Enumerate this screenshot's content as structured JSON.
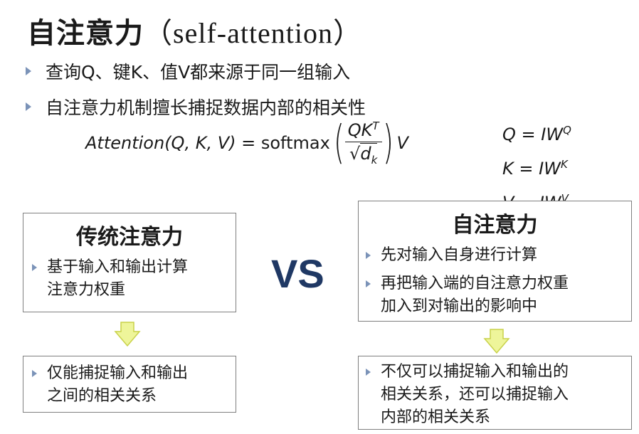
{
  "title": {
    "cn": "自注意力",
    "latin": "（self-attention）"
  },
  "bullets": [
    "查询Q、键K、值V都来源于同一组输入",
    "自注意力机制擅长捕捉数据内部的相关性"
  ],
  "formula": {
    "lhs": "Attention(Q, K, V)",
    "eq": " = softmax",
    "num": "QK",
    "num_sup": "T",
    "den": "d",
    "den_sub": "k",
    "tail": "V"
  },
  "equations": [
    {
      "lhs": "Q",
      "rhs": " = IW",
      "sup": "Q"
    },
    {
      "lhs": "K",
      "rhs": " = IW",
      "sup": "K"
    },
    {
      "lhs": "V",
      "rhs": " = IW",
      "sup": "V"
    }
  ],
  "left_box": {
    "title": "传统注意力",
    "lines": [
      "基于输入和输出计算",
      "注意力权重"
    ]
  },
  "left_result": {
    "lines": [
      "仅能捕捉输入和输出",
      "之间的相关关系"
    ]
  },
  "vs": "VS",
  "right_box": {
    "title": "自注意力",
    "items": [
      {
        "lines": [
          "先对输入自身进行计算"
        ]
      },
      {
        "lines": [
          "再把输入端的自注意力权重",
          "加入到对输出的影响中"
        ]
      }
    ]
  },
  "right_result": {
    "lines": [
      "不仅可以捕捉输入和输出的",
      "相关关系，还可以捕捉输入",
      "内部的相关关系"
    ]
  },
  "colors": {
    "bullet": "#7b93b8",
    "vs": "#1f3864",
    "arrow_fill": "#eef59a",
    "arrow_stroke": "#c9d24a",
    "border": "#7f7f7f"
  }
}
